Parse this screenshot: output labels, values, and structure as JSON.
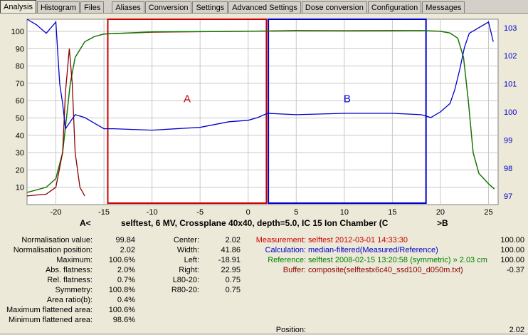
{
  "tabs": [
    "Analysis",
    "Histogram",
    "Files",
    "Aliases",
    "Conversion",
    "Settings",
    "Advanced Settings",
    "Dose conversion",
    "Configuration",
    "Messages"
  ],
  "chart_data": {
    "type": "line",
    "title": "selftest, 6 MV, Crossplane 40x40, depth=5.0, IC 15 Ion Chamber (C",
    "left_marker": "A<",
    "right_marker": ">B",
    "x_ticks": [
      "-20",
      "-15",
      "-10",
      "-5",
      "0",
      "5",
      "10",
      "15",
      "20",
      "25"
    ],
    "y_left_ticks": [
      "10",
      "20",
      "30",
      "40",
      "50",
      "60",
      "70",
      "80",
      "90",
      "100"
    ],
    "y_right_ticks": [
      "97",
      "98",
      "99",
      "100",
      "101",
      "102",
      "103"
    ],
    "xlim": [
      -23,
      26
    ],
    "ylim": [
      0,
      107
    ],
    "y2lim": [
      96.7,
      103.3
    ],
    "regions": [
      {
        "name": "A",
        "x": [
          -14.6,
          1.9
        ]
      },
      {
        "name": "B",
        "x": [
          2.1,
          18.5
        ]
      }
    ],
    "series": [
      {
        "name": "Measurement",
        "color": "#cc0000",
        "x": [
          -23,
          -21,
          -20,
          -19.3,
          -18.9,
          -18.5,
          -18,
          -17,
          -16,
          -15,
          -10,
          -5,
          0,
          5,
          10,
          15,
          18,
          20,
          21,
          21.8,
          22.4,
          22.9,
          23.4,
          24,
          25,
          25.6
        ],
        "y": [
          7,
          10,
          15,
          30,
          50,
          70,
          85,
          94,
          97,
          98.5,
          99.5,
          99.8,
          100,
          100.3,
          100.2,
          100.3,
          100.4,
          100,
          99,
          96,
          85,
          60,
          30,
          18,
          12,
          9
        ]
      },
      {
        "name": "Reference",
        "color": "#008000",
        "x": [
          -23,
          -21,
          -20,
          -19.3,
          -18.9,
          -18.5,
          -18,
          -17,
          -16,
          -15,
          -10,
          -5,
          0,
          5,
          10,
          15,
          18,
          20,
          21,
          21.8,
          22.4,
          22.9,
          23.4,
          24,
          25,
          25.6
        ],
        "y": [
          7,
          10,
          15,
          30,
          50,
          70,
          85,
          94,
          97,
          98.5,
          99.7,
          99.9,
          100.1,
          100.5,
          100.4,
          100.5,
          100.5,
          100.1,
          99.1,
          96,
          85,
          60,
          30,
          18,
          12,
          9
        ]
      },
      {
        "name": "Buffer",
        "color": "#8b0000",
        "x": [
          -23,
          -21,
          -20,
          -19.3,
          -19,
          -18.6,
          -18.3,
          -18,
          -17.5,
          -17
        ],
        "y": [
          5,
          6,
          10,
          30,
          65,
          90,
          70,
          30,
          10,
          5
        ]
      },
      {
        "name": "Calculation",
        "color": "#0000cc",
        "axis": "right",
        "x": [
          -23,
          -22,
          -21,
          -20,
          -19.6,
          -19.3,
          -19,
          -18,
          -17,
          -16,
          -15,
          -14,
          -10,
          -5,
          -2,
          0,
          1,
          2,
          5,
          10,
          15,
          18,
          19,
          20,
          21,
          21.5,
          22,
          22.5,
          23,
          24,
          25,
          25.5
        ],
        "y": [
          103.3,
          103.1,
          102.8,
          103.2,
          101,
          100.3,
          99.4,
          99.9,
          99.8,
          99.6,
          99.4,
          99.4,
          99.35,
          99.45,
          99.65,
          99.7,
          99.8,
          99.95,
          99.9,
          99.95,
          99.95,
          99.9,
          99.8,
          100,
          100.3,
          100.8,
          101.5,
          102.3,
          102.8,
          103,
          103.2,
          102.5
        ]
      }
    ]
  },
  "left_info": [
    {
      "label": "Normalisation value:",
      "value": "99.84"
    },
    {
      "label": "Normalisation position:",
      "value": "2.02"
    },
    {
      "label": "Maximum:",
      "value": "100.6%"
    },
    {
      "label": "Abs. flatness:",
      "value": "2.0%"
    },
    {
      "label": "Rel. flatness:",
      "value": "0.7%"
    },
    {
      "label": "Symmetry:",
      "value": "100.8%"
    },
    {
      "label": "Area ratio(b):",
      "value": "0.4%"
    },
    {
      "label": "Maximum flattened area:",
      "value": "100.6%"
    },
    {
      "label": "Minimum flattened area:",
      "value": "98.6%"
    }
  ],
  "mid_info": [
    {
      "label": "Center:",
      "value": "2.02"
    },
    {
      "label": "Width:",
      "value": "41.86"
    },
    {
      "label": "Left:",
      "value": "-18.91"
    },
    {
      "label": "Right:",
      "value": "22.95"
    },
    {
      "label": "L80-20:",
      "value": "0.75"
    },
    {
      "label": "R80-20:",
      "value": "0.75"
    }
  ],
  "right_info": [
    {
      "label": "Measurement:",
      "text": "selftest 2012-03-01 14:33:30",
      "value": "100.00",
      "color": "#cc0000"
    },
    {
      "label": "Calculation:",
      "text": "median-filtered(Measured/Reference)",
      "value": "100.00",
      "color": "#0000cc"
    },
    {
      "label": "Reference:",
      "text": "selftest 2008-02-15 13:20:58 (symmetric) » 2.03 cm",
      "value": "100.00",
      "color": "#008000"
    },
    {
      "label": "Buffer:",
      "text": "composite(selftestx6c40_ssd100_d050m.txt)",
      "value": "-0.37",
      "color": "#8b0000"
    }
  ],
  "position": {
    "label": "Position:",
    "value": "2.02"
  }
}
